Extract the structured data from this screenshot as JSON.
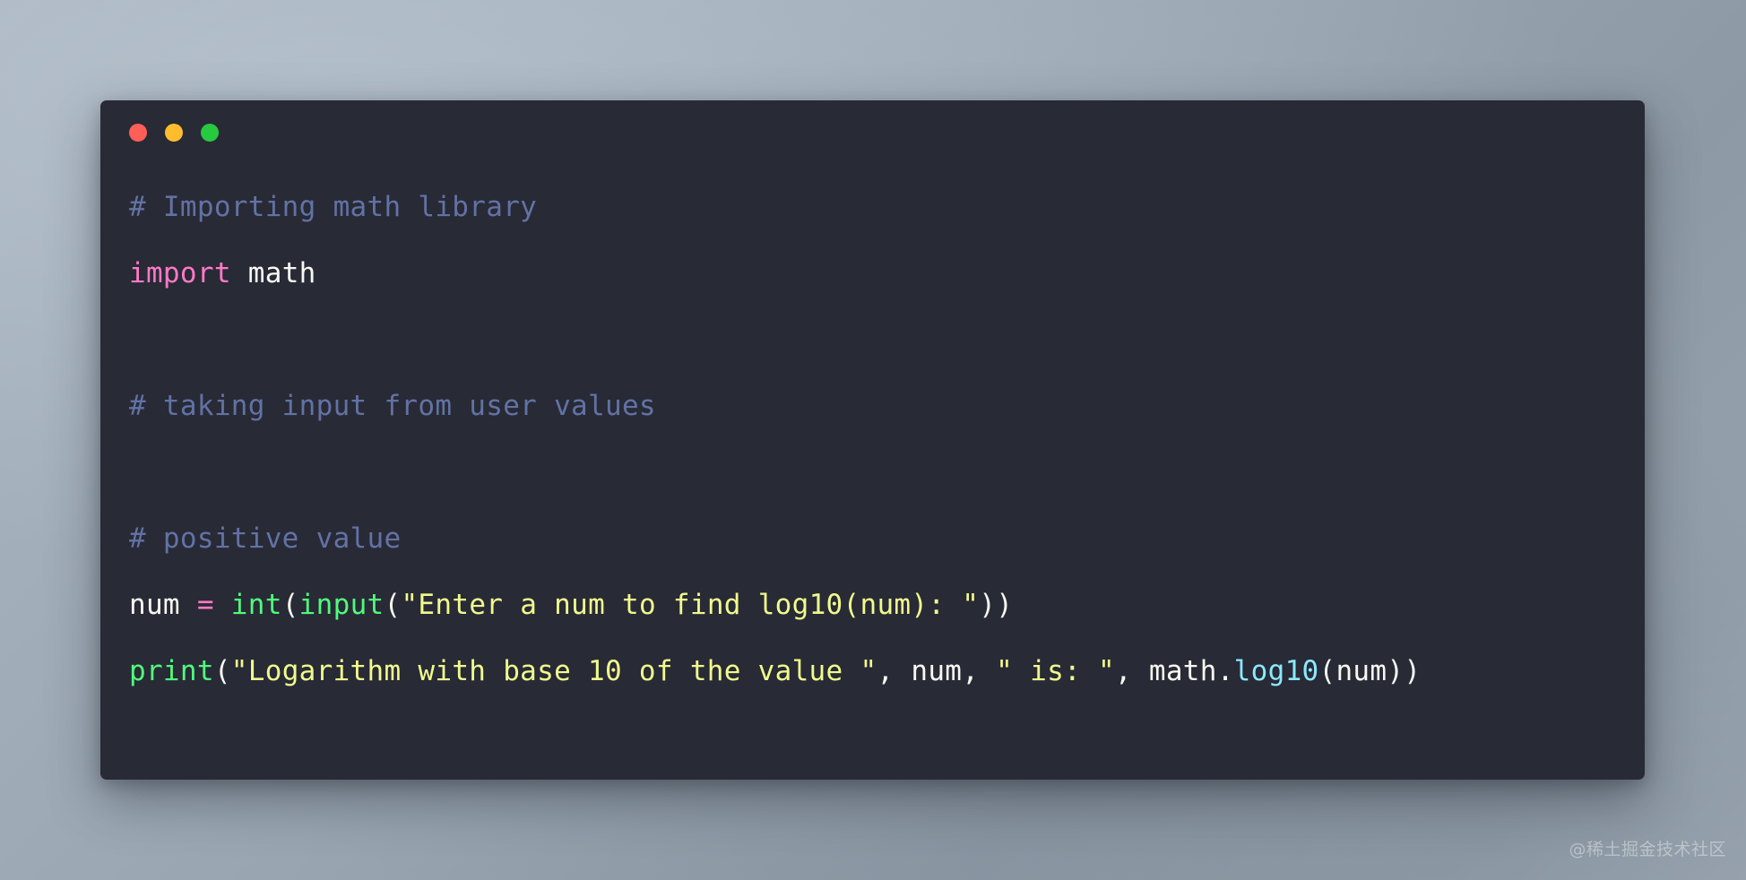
{
  "window": {
    "traffic_lights": [
      {
        "name": "close",
        "color": "#ff5f56",
        "label": "Close"
      },
      {
        "name": "minimize",
        "color": "#ffbd2e",
        "label": "Minimize"
      },
      {
        "name": "maximize",
        "color": "#27c93f",
        "label": "Maximize"
      }
    ],
    "background_color": "#282a36"
  },
  "theme": {
    "comment": "#6272a4",
    "keyword": "#ff79c6",
    "operator": "#ff79c6",
    "function": "#50fa7b",
    "string": "#f1fa8c",
    "method": "#8be9fd",
    "plain": "#f8f8f2",
    "page_background_from": "#a9b4bf",
    "page_background_to": "#8d99a5"
  },
  "code": {
    "language": "python",
    "lines": [
      {
        "index": 1,
        "text": "# Importing math library",
        "tokens": [
          {
            "t": "# Importing math library",
            "c": "comment"
          }
        ]
      },
      {
        "index": 2,
        "text": "import math",
        "tokens": [
          {
            "t": "import",
            "c": "keyword"
          },
          {
            "t": " math",
            "c": "plain"
          }
        ]
      },
      {
        "index": 3,
        "text": "",
        "tokens": []
      },
      {
        "index": 4,
        "text": "# taking input from user values",
        "tokens": [
          {
            "t": "# taking input from user values",
            "c": "comment"
          }
        ]
      },
      {
        "index": 5,
        "text": "",
        "tokens": []
      },
      {
        "index": 6,
        "text": "# positive value",
        "tokens": [
          {
            "t": "# positive value",
            "c": "comment"
          }
        ]
      },
      {
        "index": 7,
        "text": "num = int(input(\"Enter a num to find log10(num): \"))",
        "tokens": [
          {
            "t": "num ",
            "c": "plain"
          },
          {
            "t": "=",
            "c": "operator"
          },
          {
            "t": " ",
            "c": "plain"
          },
          {
            "t": "int",
            "c": "function"
          },
          {
            "t": "(",
            "c": "plain"
          },
          {
            "t": "input",
            "c": "function"
          },
          {
            "t": "(",
            "c": "plain"
          },
          {
            "t": "\"Enter a num to find log10(num): \"",
            "c": "string"
          },
          {
            "t": "))",
            "c": "plain"
          }
        ]
      },
      {
        "index": 8,
        "text": "print(\"Logarithm with base 10 of the value \", num, \" is: \", math.log10(num))",
        "tokens": [
          {
            "t": "print",
            "c": "function"
          },
          {
            "t": "(",
            "c": "plain"
          },
          {
            "t": "\"Logarithm with base 10 of the value \"",
            "c": "string"
          },
          {
            "t": ", num, ",
            "c": "plain"
          },
          {
            "t": "\" is: \"",
            "c": "string"
          },
          {
            "t": ", math.",
            "c": "plain"
          },
          {
            "t": "log10",
            "c": "method"
          },
          {
            "t": "(num))",
            "c": "plain"
          }
        ]
      }
    ]
  },
  "watermark": {
    "text": "@稀土掘金技术社区"
  }
}
